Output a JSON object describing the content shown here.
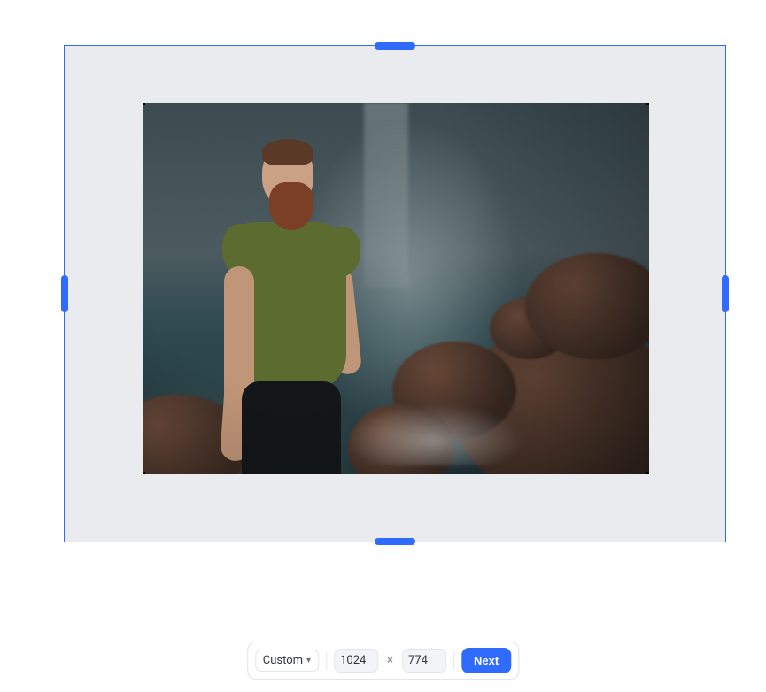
{
  "canvas": {
    "outer_selected": true,
    "image_description": "bearded man in green t-shirt standing before misty waterfall and boulders"
  },
  "toolbar": {
    "size_mode_label": "Custom",
    "width_value": "1024",
    "height_value": "774",
    "separator_label": "×",
    "next_label": "Next"
  }
}
